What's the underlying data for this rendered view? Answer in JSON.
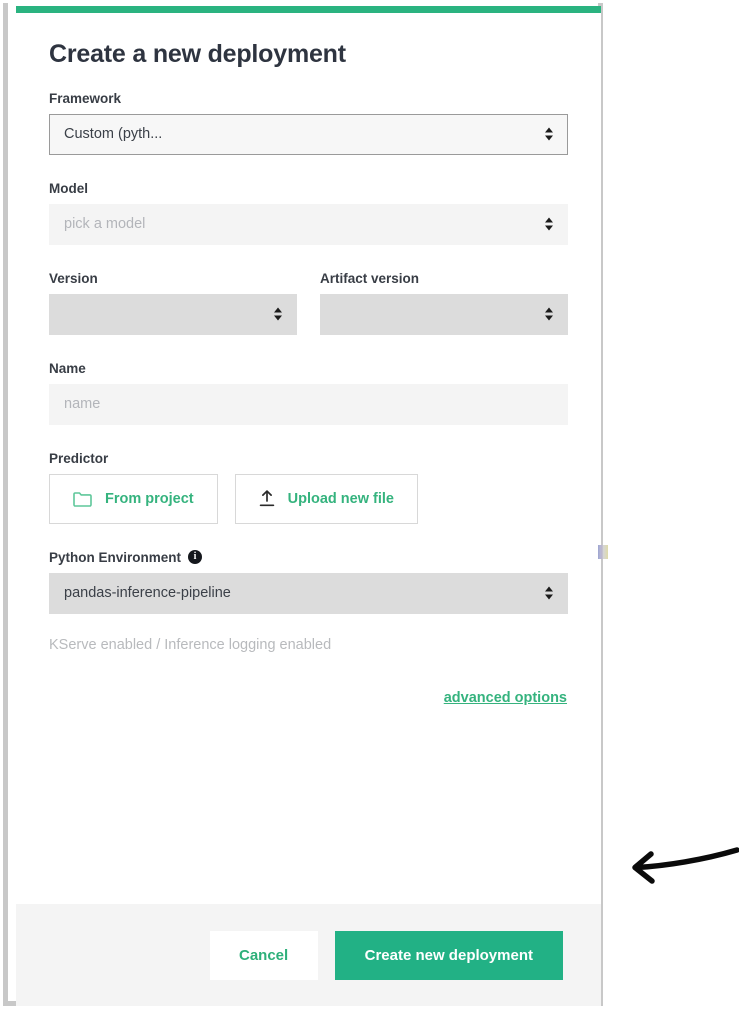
{
  "modal": {
    "accent_color": "#2ab380",
    "title": "Create a new deployment",
    "fields": {
      "framework": {
        "label": "Framework",
        "value": "Custom (pyth...",
        "icon": "select-updown-icon"
      },
      "model": {
        "label": "Model",
        "placeholder": "pick a model",
        "value": "",
        "icon": "select-updown-icon"
      },
      "version": {
        "label": "Version",
        "value": "",
        "icon": "select-updown-icon"
      },
      "artifact_version": {
        "label": "Artifact version",
        "value": "",
        "icon": "select-updown-icon"
      },
      "name": {
        "label": "Name",
        "placeholder": "name",
        "value": ""
      },
      "predictor": {
        "label": "Predictor",
        "from_project_label": "From project",
        "from_project_icon": "folder-icon",
        "upload_label": "Upload new file",
        "upload_icon": "upload-icon"
      },
      "python_environment": {
        "label": "Python Environment",
        "info_icon": "info-icon",
        "info_glyph": "i",
        "value": "pandas-inference-pipeline",
        "icon": "select-updown-icon"
      }
    },
    "hint": "KServe enabled / Inference logging enabled",
    "advanced_options_label": "advanced options",
    "footer": {
      "cancel_label": "Cancel",
      "submit_label": "Create new deployment",
      "submit_color": "#22b185",
      "link_color": "#2eb07a"
    }
  },
  "annotation": {
    "type": "hand-drawn-arrow-left",
    "points_to": "advanced options",
    "color": "#0b0b0b"
  }
}
